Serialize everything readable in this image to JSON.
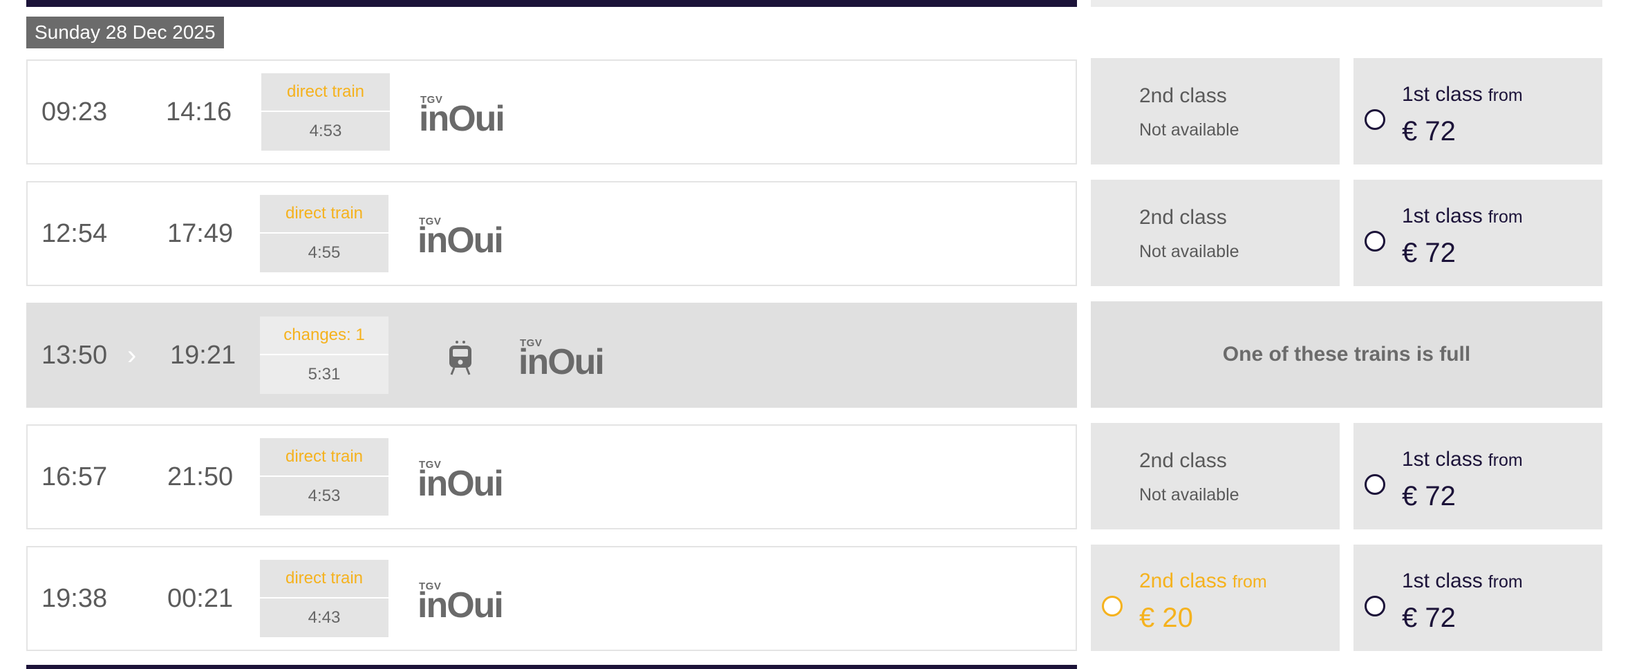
{
  "date_label": "Sunday 28 Dec 2025",
  "brand": {
    "tgv": "TGV",
    "inoui": "inOui"
  },
  "colors": {
    "navy": "#1c1339",
    "gold": "#f5b21e",
    "grey": "#6b6b6b"
  },
  "rows": [
    {
      "departure": "09:23",
      "arrival": "14:16",
      "train_type": "direct train",
      "duration": "4:53",
      "second_class": {
        "label": "2nd class",
        "status": "Not available"
      },
      "first_class": {
        "label": "1st class",
        "from": "from",
        "price": "€ 72"
      }
    },
    {
      "departure": "12:54",
      "arrival": "17:49",
      "train_type": "direct train",
      "duration": "4:55",
      "second_class": {
        "label": "2nd class",
        "status": "Not available"
      },
      "first_class": {
        "label": "1st class",
        "from": "from",
        "price": "€ 72"
      }
    },
    {
      "departure": "13:50",
      "arrival": "19:21",
      "train_type": "changes: 1",
      "duration": "5:31",
      "full_message": "One of these trains is full",
      "icons": [
        "chevron-right-icon",
        "tram-icon"
      ]
    },
    {
      "departure": "16:57",
      "arrival": "21:50",
      "train_type": "direct train",
      "duration": "4:53",
      "second_class": {
        "label": "2nd class",
        "status": "Not available"
      },
      "first_class": {
        "label": "1st class",
        "from": "from",
        "price": "€ 72"
      }
    },
    {
      "departure": "19:38",
      "arrival": "00:21",
      "train_type": "direct train",
      "duration": "4:43",
      "second_class": {
        "label": "2nd class",
        "from": "from",
        "price": "€ 20"
      },
      "first_class": {
        "label": "1st class",
        "from": "from",
        "price": "€ 72"
      }
    }
  ]
}
